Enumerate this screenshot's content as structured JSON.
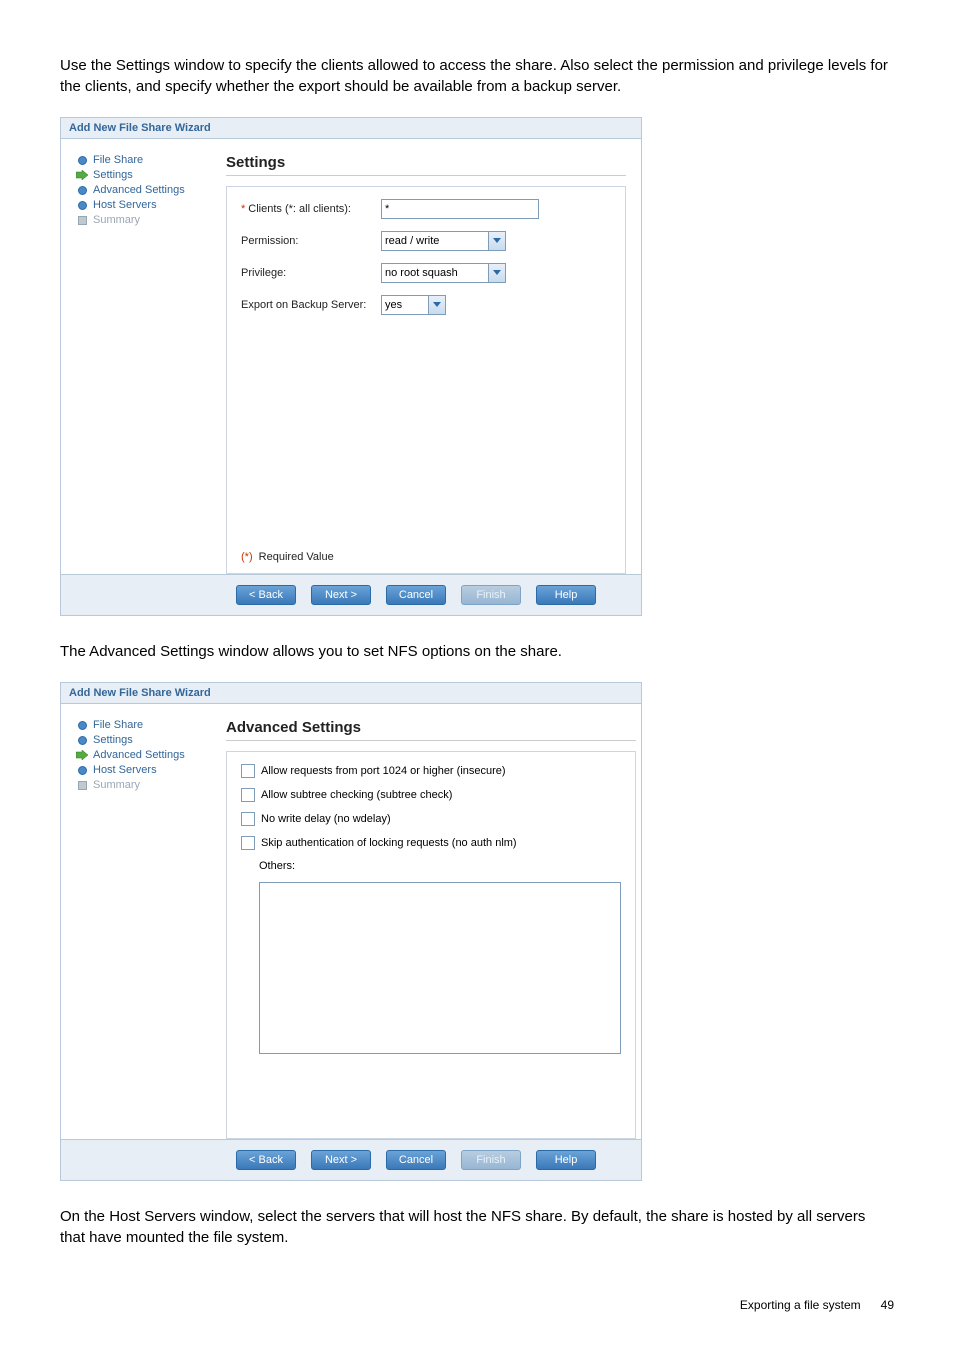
{
  "intro1": "Use the Settings window to specify the clients allowed to access the share. Also select the permission and privilege levels for the clients, and specify whether the export should be available from a backup server.",
  "intro2": "The Advanced Settings window allows you to set NFS options on the share.",
  "intro3": "On the Host Servers window, select the servers that will host the NFS share. By default, the share is hosted by all servers that have mounted the file system.",
  "wizard1": {
    "title": "Add New File Share Wizard",
    "nav": {
      "item0": "File Share",
      "item1": "Settings",
      "item2": "Advanced Settings",
      "item3": "Host Servers",
      "item4": "Summary"
    },
    "heading": "Settings",
    "fields": {
      "clients_label": "Clients (*: all clients):",
      "clients_value": "*",
      "permission_label": "Permission:",
      "permission_value": "read / write",
      "privilege_label": "Privilege:",
      "privilege_value": "no root squash",
      "backup_label": "Export on Backup Server:",
      "backup_value": "yes"
    },
    "required_note": "(*) Required Value"
  },
  "wizard2": {
    "title": "Add New File Share Wizard",
    "nav": {
      "item0": "File Share",
      "item1": "Settings",
      "item2": "Advanced Settings",
      "item3": "Host Servers",
      "item4": "Summary"
    },
    "heading": "Advanced Settings",
    "checks": {
      "c0": "Allow requests from port 1024 or higher (insecure)",
      "c1": "Allow subtree checking (subtree check)",
      "c2": "No write delay (no wdelay)",
      "c3": "Skip authentication of locking requests (no auth nlm)"
    },
    "others_label": "Others:"
  },
  "buttons": {
    "back": "< Back",
    "next": "Next >",
    "cancel": "Cancel",
    "finish": "Finish",
    "help": "Help"
  },
  "footer": {
    "section": "Exporting a file system",
    "page": "49"
  }
}
